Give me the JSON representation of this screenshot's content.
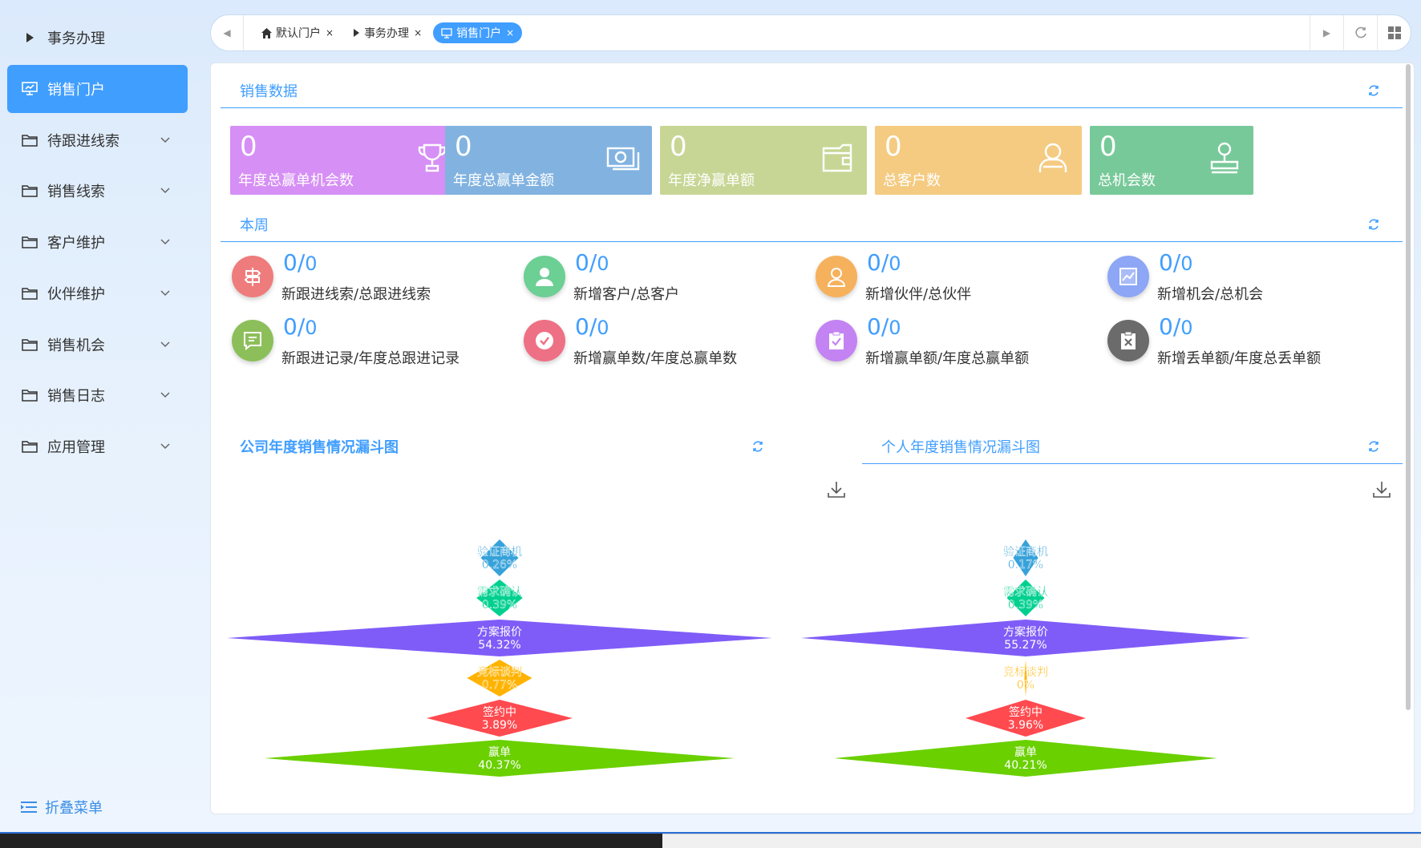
{
  "sidebar": {
    "items": [
      {
        "label": "事务办理",
        "icon": "caret-right-icon",
        "active": false
      },
      {
        "label": "销售门户",
        "icon": "monitor-icon",
        "active": true
      },
      {
        "label": "待跟进线索",
        "icon": "folder-icon"
      },
      {
        "label": "销售线索",
        "icon": "folder-icon"
      },
      {
        "label": "客户维护",
        "icon": "folder-icon"
      },
      {
        "label": "伙伴维护",
        "icon": "folder-icon"
      },
      {
        "label": "销售机会",
        "icon": "folder-icon"
      },
      {
        "label": "销售日志",
        "icon": "folder-icon"
      },
      {
        "label": "应用管理",
        "icon": "folder-icon"
      }
    ],
    "collapse_label": "折叠菜单"
  },
  "tabs": [
    {
      "label": "默认门户",
      "icon": "home-icon"
    },
    {
      "label": "事务办理",
      "icon": "caret-right-icon"
    },
    {
      "label": "销售门户",
      "icon": "monitor-icon",
      "active": true
    }
  ],
  "tab_close": "×",
  "sales_data": {
    "title": "销售数据",
    "cards": [
      {
        "value": "0",
        "label": "年度总赢单机会数",
        "color": "#d68ff5",
        "icon": "trophy-icon"
      },
      {
        "value": "0",
        "label": "年度总赢单金额",
        "color": "#82b3e0",
        "icon": "money-icon"
      },
      {
        "value": "0",
        "label": "年度净赢单额",
        "color": "#c7d695",
        "icon": "wallet-icon"
      },
      {
        "value": "0",
        "label": "总客户数",
        "color": "#f5cb82",
        "icon": "user-icon"
      },
      {
        "value": "0",
        "label": "总机会数",
        "color": "#78c999",
        "icon": "stamp-icon"
      }
    ]
  },
  "week": {
    "title": "本周",
    "stats": [
      {
        "value": "0/",
        "sub": "0",
        "label": "新跟进线索/总跟进线索",
        "color": "#ef7c7c",
        "icon": "signpost-icon"
      },
      {
        "value": "0/",
        "sub": "0",
        "label": "新增客户/总客户",
        "color": "#6ccf94",
        "icon": "person-icon"
      },
      {
        "value": "0/",
        "sub": "0",
        "label": "新增伙伴/总伙伴",
        "color": "#f6b15d",
        "icon": "user-outline-icon"
      },
      {
        "value": "0/",
        "sub": "0",
        "label": "新增机会/总机会",
        "color": "#8da6f5",
        "icon": "trend-icon"
      },
      {
        "value": "0/",
        "sub": "0",
        "label": "新跟进记录/年度总跟进记录",
        "color": "#8cbf5a",
        "icon": "message-icon"
      },
      {
        "value": "0/",
        "sub": "0",
        "label": "新增赢单数/年度总赢单数",
        "color": "#ee7084",
        "icon": "check-circle-icon"
      },
      {
        "value": "0/",
        "sub": "0",
        "label": "新增赢单额/年度总赢单额",
        "color": "#c383f2",
        "icon": "clipboard-check-icon"
      },
      {
        "value": "0/",
        "sub": "0",
        "label": "新增丢单额/年度总丢单额",
        "color": "#6b6b6b",
        "icon": "clipboard-x-icon"
      }
    ]
  },
  "funnels": {
    "company_title": "公司年度销售情况漏斗图",
    "personal_title": "个人年度销售情况漏斗图"
  },
  "chart_data": [
    {
      "type": "funnel",
      "title": "公司年度销售情况漏斗图",
      "categories": [
        "验证商机",
        "需求确认",
        "方案报价",
        "竞标谈判",
        "签约中",
        "赢单"
      ],
      "values": [
        0.26,
        0.39,
        54.32,
        0.77,
        3.89,
        40.37
      ],
      "labels": [
        "0.26%",
        "0.39%",
        "54.32%",
        "0.77%",
        "3.89%",
        "40.37%"
      ],
      "colors": [
        "#37a2da",
        "#00d08f",
        "#7f5cf8",
        "#ffb300",
        "#ff4a4f",
        "#6ad000"
      ]
    },
    {
      "type": "funnel",
      "title": "个人年度销售情况漏斗图",
      "categories": [
        "验证商机",
        "需求确认",
        "方案报价",
        "竞标谈判",
        "签约中",
        "赢单"
      ],
      "values": [
        0.17,
        0.39,
        55.27,
        0,
        3.96,
        40.21
      ],
      "labels": [
        "0.17%",
        "0.39%",
        "55.27%",
        "0%",
        "3.96%",
        "40.21%"
      ],
      "colors": [
        "#37a2da",
        "#00d08f",
        "#7f5cf8",
        "#ffb300",
        "#ff4a4f",
        "#6ad000"
      ]
    }
  ]
}
